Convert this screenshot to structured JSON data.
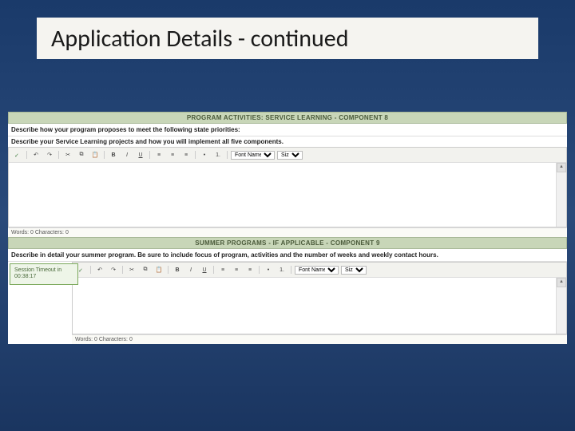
{
  "title": "Application Details - continued",
  "section1": {
    "header": "PROGRAM ACTIVITIES: SERVICE LEARNING - COMPONENT 8",
    "prompt": "Describe how your program proposes to meet the following state priorities:",
    "subprompt": "Describe your Service Learning projects and how you will implement all five components.",
    "status": "Words: 0   Characters: 0"
  },
  "section2": {
    "header": "SUMMER PROGRAMS - IF APPLICABLE - COMPONENT 9",
    "prompt": "Describe in detail your summer program. Be sure to include focus of program, activities and the number of weeks and weekly contact hours.",
    "status": "Words: 0   Characters: 0"
  },
  "toolbar": {
    "font_select": "Font Name",
    "size_select": "Size"
  },
  "session": {
    "line1": "Session Timeout in",
    "line2": "00:38:17"
  }
}
